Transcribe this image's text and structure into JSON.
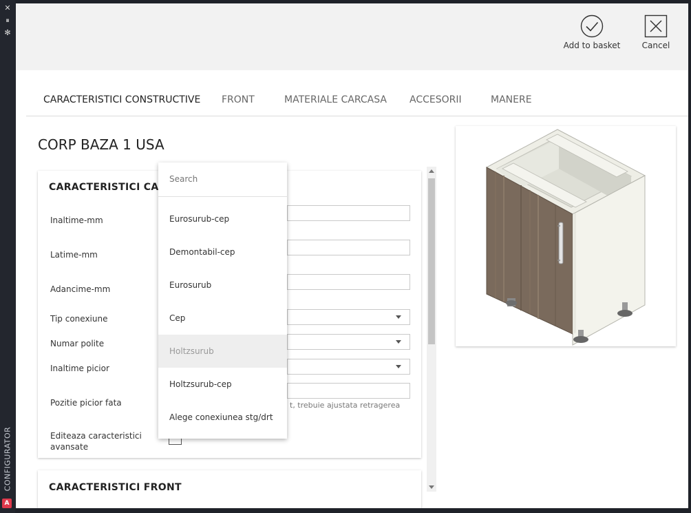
{
  "sidebar": {
    "buttons": [
      "✕",
      "⏸",
      "✻"
    ],
    "label": "CONFIGURATOR",
    "brand": "A"
  },
  "toolbar": {
    "add_label": "Add to basket",
    "cancel_label": "Cancel"
  },
  "tabs": [
    {
      "label": "CARACTERISTICI CONSTRUCTIVE",
      "active": true
    },
    {
      "label": "FRONT",
      "active": false
    },
    {
      "label": "MATERIALE CARCASA",
      "active": false
    },
    {
      "label": "ACCESORII",
      "active": false
    },
    {
      "label": "MANERE",
      "active": false
    }
  ],
  "page_title": "CORP BAZA 1 USA",
  "section1": {
    "title": "CARACTERISTICI CA",
    "fields": [
      {
        "label": "Inaltime-mm",
        "type": "input",
        "value": ""
      },
      {
        "label": "Latime-mm",
        "type": "input",
        "value": ""
      },
      {
        "label": "Adancime-mm",
        "type": "input",
        "value": ""
      },
      {
        "label": "Tip conexiune",
        "type": "select",
        "value": ""
      },
      {
        "label": "Numar polite",
        "type": "select",
        "value": ""
      },
      {
        "label": "Inaltime picior",
        "type": "select",
        "value": ""
      },
      {
        "label": "Pozitie picior fata",
        "type": "input",
        "value": ""
      }
    ],
    "hint": "t, trebuie ajustata retragerea",
    "advanced_label_1": "Editeaza caracteristici",
    "advanced_label_2": "avansate"
  },
  "section2": {
    "title": "CARACTERISTICI FRONT"
  },
  "dropdown": {
    "search_placeholder": "Search",
    "options": [
      {
        "label": "Eurosurub-cep",
        "highlighted": false
      },
      {
        "label": "Demontabil-cep",
        "highlighted": false
      },
      {
        "label": "Eurosurub",
        "highlighted": false
      },
      {
        "label": "Cep",
        "highlighted": false
      },
      {
        "label": "Holtzsurub",
        "highlighted": true
      },
      {
        "label": "Holtzsurub-cep",
        "highlighted": false
      },
      {
        "label": "Alege conexiunea stg/drt",
        "highlighted": false
      }
    ]
  },
  "colors": {
    "frame_bg": "#1f2229",
    "topbar_bg": "#f2f2f2",
    "brand": "#e0394c",
    "door_wood": "#7a6a5c",
    "cabinet_body": "#f3f3ec"
  }
}
